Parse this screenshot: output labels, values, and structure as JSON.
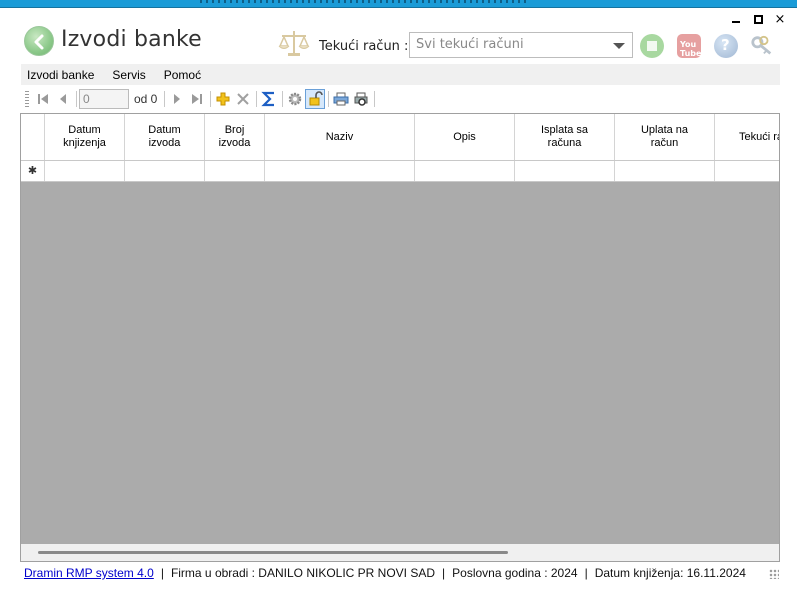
{
  "window": {
    "title": "Izvodi banke",
    "minimize_label": "minimize",
    "maximize_label": "maximize",
    "close_label": "×"
  },
  "header": {
    "account_label": "Tekući račun :",
    "account_value": "Svi tekući računi",
    "youtube_text": "You Tube",
    "help_text": "?"
  },
  "menu": {
    "items": [
      {
        "label": "Izvodi banke"
      },
      {
        "label": "Servis"
      },
      {
        "label": "Pomoć"
      }
    ]
  },
  "navigator": {
    "position": "0",
    "of_label": "od 0"
  },
  "grid": {
    "columns": [
      {
        "label": "Datum\nknjizenja"
      },
      {
        "label": "Datum\nizvoda"
      },
      {
        "label": "Broj\nizvoda"
      },
      {
        "label": "Naziv"
      },
      {
        "label": "Opis"
      },
      {
        "label": "Isplata sa\nračuna"
      },
      {
        "label": "Uplata na\nračun"
      },
      {
        "label": "Tekući ra"
      }
    ],
    "new_row_marker": "✱"
  },
  "status": {
    "app_link": "Dramin RMP system 4.0",
    "separator": "|",
    "company": "Firma u obradi : DANILO NIKOLIC PR NOVI SAD",
    "year": "Poslovna godina : 2024",
    "posting_date": "Datum knjiženja: 16.11.2024"
  }
}
